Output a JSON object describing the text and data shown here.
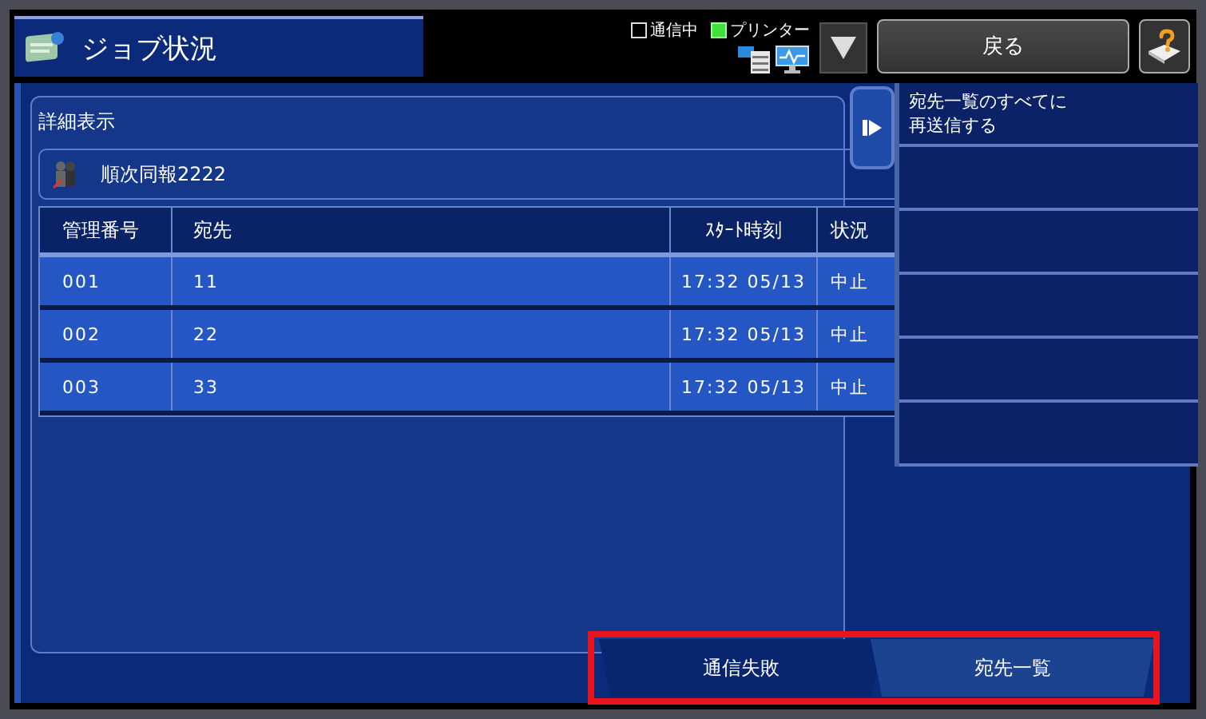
{
  "window": {
    "title": "ジョブ状況"
  },
  "status": [
    {
      "label": "通信中",
      "on": false
    },
    {
      "label": "プリンター",
      "on": true
    }
  ],
  "back_button": "戻る",
  "section_title": "詳細表示",
  "job": {
    "name": "順次同報2222"
  },
  "table": {
    "columns": [
      "管理番号",
      "宛先",
      "ｽﾀｰﾄ時刻",
      "状況"
    ],
    "rows": [
      [
        "001",
        "11",
        "17:32 05/13",
        "中止"
      ],
      [
        "002",
        "22",
        "17:32 05/13",
        "中止"
      ],
      [
        "003",
        "33",
        "17:32 05/13",
        "中止"
      ]
    ]
  },
  "side_menu": {
    "items": [
      "宛先一覧のすべてに再送信する"
    ]
  },
  "tabs": [
    {
      "label": "通信失敗",
      "selected": false
    },
    {
      "label": "宛先一覧",
      "selected": true
    }
  ]
}
